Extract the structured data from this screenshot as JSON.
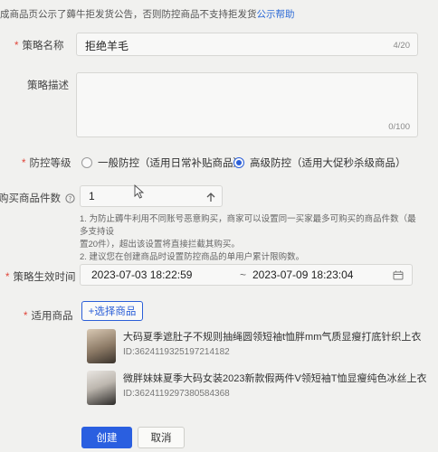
{
  "notice": {
    "text": "成商品页公示了薅牛拒发货公告，否则防控商品不支持拒发货",
    "link": "公示帮助"
  },
  "form": {
    "name": {
      "label": "策略名称",
      "required": true,
      "value": "拒绝羊毛",
      "counter": "4/20"
    },
    "description": {
      "label": "策略描述",
      "required": false,
      "value": "",
      "counter": "0/100"
    },
    "level": {
      "label": "防控等级",
      "required": true,
      "options": [
        {
          "label": "一般防控（适用日常补贴商品）",
          "checked": false
        },
        {
          "label": "高级防控（适用大促秒杀级商品）",
          "checked": true
        }
      ]
    },
    "quantity": {
      "label": "购买商品件数",
      "value": "1",
      "tips": [
        "1. 为防止薅牛利用不同账号恶意购买，商家可以设置同一买家最多可购买的商品件数（最多支持设",
        "置20件），超出该设置将直接拦截其购买。",
        "2. 建议您在创建商品时设置防控商品的单用户累计限购数。"
      ]
    },
    "time": {
      "label": "策略生效时间",
      "required": true,
      "start": "2023-07-03 18:22:59",
      "separator": "~",
      "end": "2023-07-09 18:23:04"
    },
    "products": {
      "label": "适用商品",
      "required": true,
      "select_label": "+选择商品",
      "items": [
        {
          "name": "大码夏季遮肚子不规则抽绳圆领短袖t恤胖mm气质显瘦打底针织上衣",
          "id": "ID:3624119325197214182"
        },
        {
          "name": "微胖妹妹夏季大码女装2023新款假两件V领短袖T恤显瘦纯色冰丝上衣",
          "id": "ID:3624119297380584368"
        }
      ]
    }
  },
  "actions": {
    "create": "创建",
    "cancel": "取消"
  },
  "colors": {
    "primary": "#2a5fe0",
    "required": "#e0463a",
    "link": "#2d6bd6"
  }
}
